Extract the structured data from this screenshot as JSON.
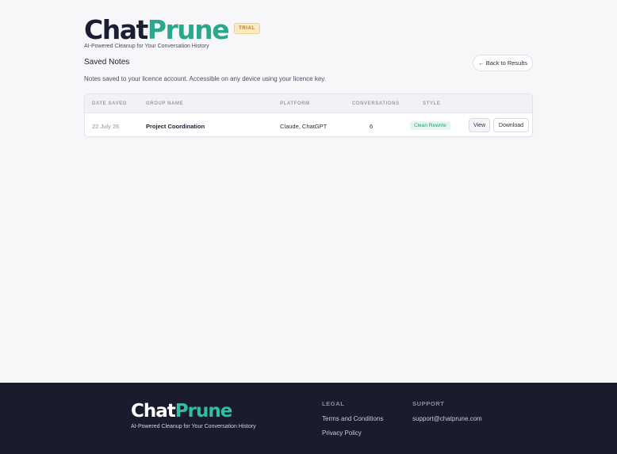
{
  "brand": {
    "name_part1": "Chat",
    "name_part2": "Prune",
    "badge": "TRIAL",
    "tagline": "AI-Powered Cleanup for Your Conversation History",
    "color_dark": "#1b1d33",
    "color_accent": "#2aa88d"
  },
  "page": {
    "title": "Saved Notes",
    "back_button": "← Back to Results",
    "description": "Notes saved to your licence account. Accessible on any device using your licence key."
  },
  "table": {
    "columns": [
      "DATE SAVED",
      "GROUP NAME",
      "PLATFORM",
      "CONVERSATIONS",
      "STYLE"
    ],
    "rows": [
      {
        "date": "22 July 26",
        "group": "Project Coordination",
        "platform": "Claude, ChatGPT",
        "conversations": "6",
        "style": "Clean Rewrite",
        "view_label": "View",
        "download_label": "Download"
      }
    ]
  },
  "footer": {
    "name_part1": "Chat",
    "name_part2": "Prune",
    "tagline": "AI-Powered Cleanup for Your Conversation History",
    "legal_heading": "LEGAL",
    "legal_links": [
      "Terms and Conditions",
      "Privacy Policy"
    ],
    "support_heading": "SUPPORT",
    "support_email": "support@chatprune.com"
  }
}
